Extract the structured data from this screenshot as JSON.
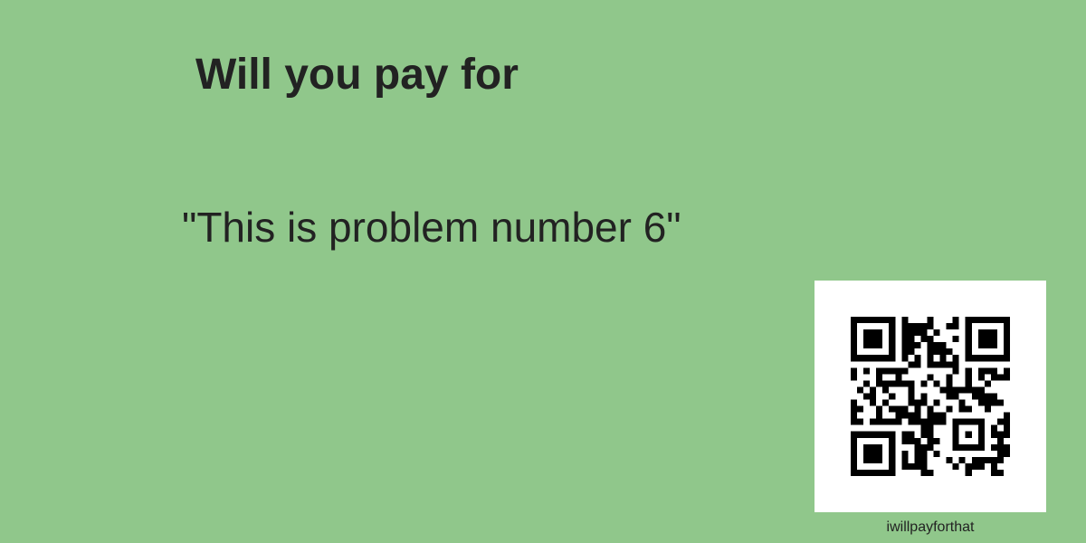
{
  "colors": {
    "background": "#90c78b",
    "text": "#222222",
    "qr_background": "#ffffff",
    "qr_modules": "#000000"
  },
  "heading": "Will you pay for",
  "quote": "\"This is problem number 6\"",
  "site_label": "iwillpayforthat",
  "qr_icon": "qr-code-icon"
}
